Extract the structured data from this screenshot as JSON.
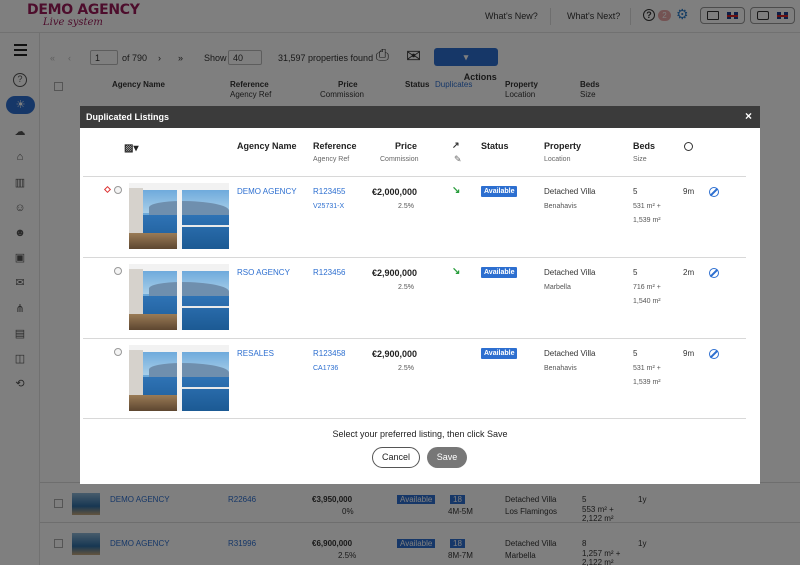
{
  "topbar": {
    "logo_main": "DEMO AGENCY",
    "logo_sub": "Live system",
    "whats_new": "What's New?",
    "whats_next": "What's Next?",
    "notification_count": "2"
  },
  "pager": {
    "page": "1",
    "of_pages": "of 790",
    "show_label": "Show",
    "show_value": "40",
    "properties_found": "31,597 properties found",
    "actions_label": "Actions"
  },
  "list_header": {
    "agency_name": "Agency Name",
    "reference": "Reference",
    "agency_ref": "Agency Ref",
    "price": "Price",
    "commission": "Commission",
    "status": "Status",
    "duplicates": "Duplicates",
    "property": "Property",
    "location": "Location",
    "beds": "Beds",
    "size": "Size"
  },
  "background_rows": [
    {
      "agency": "DEMO AGENCY",
      "ref": "R22646",
      "price": "€3,950,000",
      "commission": "0%",
      "status": "Available",
      "beds_badge": "18",
      "dates": "4M-5M",
      "property": "Detached Villa",
      "location": "Los Flamingos",
      "beds": "5",
      "size1": "553 m² +",
      "size2": "2,122 m²",
      "age": "1y"
    },
    {
      "agency": "DEMO AGENCY",
      "ref": "R31996",
      "price": "€6,900,000",
      "commission": "2.5%",
      "status": "Available",
      "beds_badge": "18",
      "dates": "8M-7M",
      "property": "Detached Villa",
      "location": "Marbella",
      "beds": "8",
      "size1": "1,257 m² +",
      "size2": "2,122 m²",
      "age": "1y"
    }
  ],
  "modal": {
    "title": "Duplicated Listings",
    "close": "×",
    "headers": {
      "agency_name": "Agency Name",
      "reference": "Reference",
      "agency_ref": "Agency Ref",
      "price": "Price",
      "commission": "Commission",
      "status": "Status",
      "property": "Property",
      "location": "Location",
      "beds": "Beds",
      "size": "Size"
    },
    "rows": [
      {
        "agency": "DEMO AGENCY",
        "reference": "R123455",
        "agency_ref": "V25731-X",
        "price": "€2,000,000",
        "commission": "2.5%",
        "status": "Available",
        "property": "Detached Villa",
        "location": "Benahavis",
        "beds": "5",
        "size1": "531 m² +",
        "size2": "1,539 m²",
        "age": "9m"
      },
      {
        "agency": "RSO AGENCY",
        "reference": "R123456",
        "agency_ref": "",
        "price": "€2,900,000",
        "commission": "2.5%",
        "status": "Available",
        "property": "Detached Villa",
        "location": "Marbella",
        "beds": "5",
        "size1": "716 m² +",
        "size2": "1,540 m²",
        "age": "2m"
      },
      {
        "agency": "RESALES",
        "reference": "R123458",
        "agency_ref": "CA1736",
        "price": "€2,900,000",
        "commission": "2.5%",
        "status": "Available",
        "property": "Detached Villa",
        "location": "Benahavis",
        "beds": "5",
        "size1": "531 m² +",
        "size2": "1,539 m²",
        "age": "9m"
      }
    ],
    "prompt": "Select your preferred listing, then click Save",
    "cancel_label": "Cancel",
    "save_label": "Save"
  },
  "colors": {
    "brand": "#9b1b59",
    "accent": "#2d6fd0",
    "status_available": "#2d6fd0",
    "modal_header": "#3b3b3b"
  },
  "icons": [
    "help-icon",
    "gear-icon",
    "monitor-icon",
    "chat-icon",
    "uk-flag-icon",
    "hamburger-icon",
    "lightbulb-icon",
    "home-icon",
    "building-icon",
    "user-icon",
    "users-icon",
    "briefcase-icon",
    "mail-icon",
    "sitemap-icon",
    "book-icon",
    "box-icon",
    "logout-icon",
    "image-icon",
    "chart-icon",
    "clock-icon",
    "ban-icon",
    "arrow-down-right-icon"
  ]
}
